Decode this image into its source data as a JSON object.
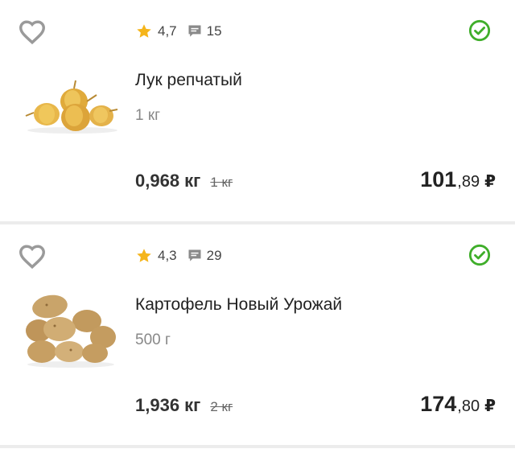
{
  "products": [
    {
      "rating": "4,7",
      "reviews": "15",
      "name": "Лук репчатый",
      "unit": "1 кг",
      "weight_actual": "0,968 кг",
      "weight_ordered": "1 кг",
      "price_int": "101",
      "price_frac": ",89",
      "currency": "₽",
      "image": "onion-image"
    },
    {
      "rating": "4,3",
      "reviews": "29",
      "name": "Картофель Новый Урожай",
      "unit": "500 г",
      "weight_actual": "1,936 кг",
      "weight_ordered": "2 кг",
      "price_int": "174",
      "price_frac": ",80",
      "currency": "₽",
      "image": "potato-image"
    }
  ],
  "colors": {
    "accent_green": "#3fae2a",
    "star": "#f5b51b",
    "heart": "#9a9a9a"
  }
}
